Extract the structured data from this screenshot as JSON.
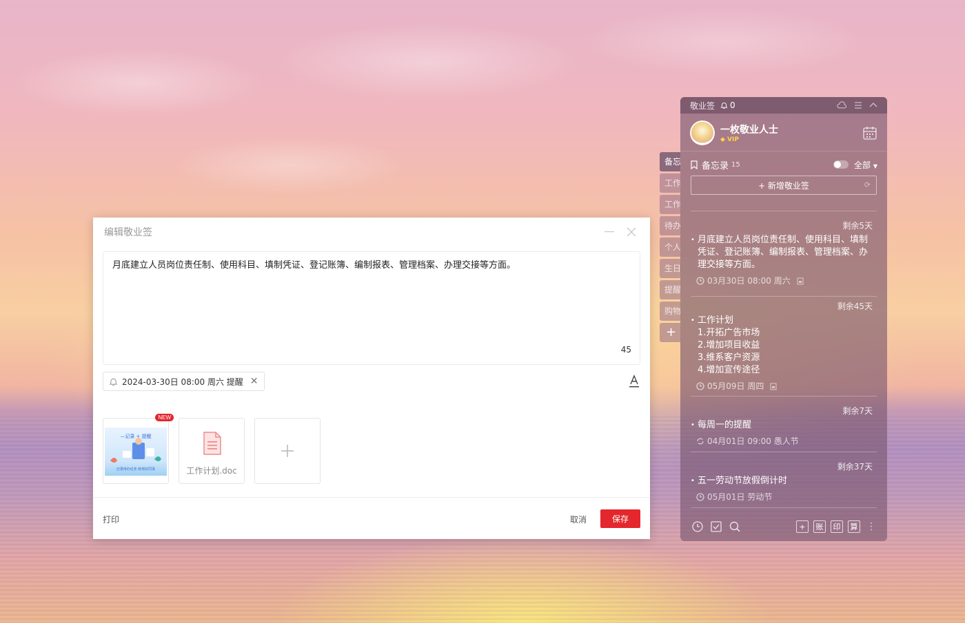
{
  "dialog": {
    "title": "编辑敬业签",
    "content": "月底建立人员岗位责任制、使用科目、填制凭证、登记账簿、编制报表、管理档案、办理交接等方面。",
    "char_count": "45",
    "reminder": "2024-03-30日 08:00 周六 提醒",
    "attachments": [
      {
        "type": "image",
        "badge": "NEW",
        "thumb_title": "—记录 + 提醒",
        "thumb_footer": "记录待办任务 新增好同事"
      },
      {
        "type": "doc",
        "name": "工作计划.doc"
      }
    ],
    "print_label": "打印",
    "cancel_label": "取消",
    "save_label": "保存"
  },
  "side_tabs": [
    "备忘",
    "工作",
    "工作",
    "待办",
    "个人",
    "生日",
    "提醒",
    "购物",
    "+"
  ],
  "panel": {
    "app_name": "敬业签",
    "bell_count": "0",
    "user_name": "一枚敬业人士",
    "vip_label": "VIP",
    "category": "备忘录",
    "category_count": "15",
    "filter": "全部",
    "new_note_label": "+ 新增敬业签",
    "notes": [
      {
        "remain": "剩余5天",
        "lines": [
          "月底建立人员岗位责任制、使用科目、填制",
          "凭证、登记账簿、编制报表、管理档案、办",
          "理交接等方面。"
        ],
        "meta": "03月30日 08:00 周六"
      },
      {
        "remain": "剩余45天",
        "lines": [
          "工作计划",
          "1.开拓广告市场",
          "2.增加项目收益",
          "3.维系客户资源",
          "4.增加宣传途径"
        ],
        "meta": "05月09日 周四"
      },
      {
        "remain": "剩余7天",
        "lines": [
          "每周一的提醒"
        ],
        "meta": "04月01日 09:00 愚人节"
      },
      {
        "remain": "剩余37天",
        "lines": [
          "五一劳动节放假倒计时"
        ],
        "meta": "05月01日 劳动节"
      }
    ],
    "bottom_boxes": [
      "+",
      "账",
      "印",
      "算"
    ]
  },
  "colors": {
    "accent": "#e4262d",
    "panel": "#785570"
  }
}
